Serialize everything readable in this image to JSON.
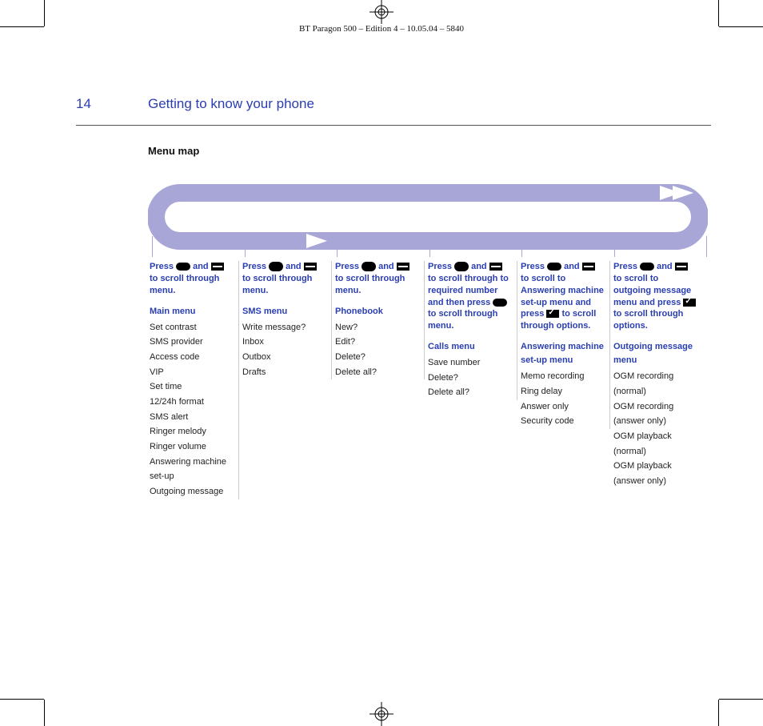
{
  "header": "BT Paragon 500 – Edition 4 – 10.05.04 – 5840",
  "page_number": "14",
  "section_title": "Getting to know your phone",
  "menu_map_heading": "Menu map",
  "cols": [
    {
      "instr_parts": {
        "pre": "Press ",
        "mid": " and ",
        "post": " to scroll through menu."
      },
      "lead_icon": "pill",
      "scroll_icon": "card",
      "menu_title": "Main menu",
      "items": [
        "Set contrast",
        "SMS provider",
        "Access code",
        "VIP",
        "Set time",
        "12/24h format",
        "SMS alert",
        "Ringer melody",
        "Ringer volume",
        "Answering machine set-up",
        "Outgoing message"
      ]
    },
    {
      "instr_parts": {
        "pre": "Press ",
        "mid": " and ",
        "post": " to scroll through menu."
      },
      "lead_icon": "oval",
      "scroll_icon": "card",
      "menu_title": "SMS menu",
      "items": [
        "Write message?",
        "Inbox",
        "Outbox",
        "Drafts"
      ]
    },
    {
      "instr_parts": {
        "pre": "Press ",
        "mid": " and ",
        "post": " to scroll through menu."
      },
      "lead_icon": "oval",
      "scroll_icon": "card",
      "menu_title": "Phonebook",
      "items": [
        "New?",
        "Edit?",
        "Delete?",
        "Delete all?"
      ]
    },
    {
      "instr_parts": {
        "pre": "Press ",
        "mid": " and ",
        "mid2": " to scroll through to required number and then press ",
        "post": " to scroll through menu."
      },
      "lead_icon": "oval",
      "pre_icon2": "card",
      "scroll_icon": "pill",
      "menu_title": "Calls menu",
      "items": [
        "Save number",
        "Delete?",
        "Delete all?"
      ]
    },
    {
      "instr_parts": {
        "pre": "Press ",
        "mid": " and ",
        "mid2": " to scroll to Answering machine set-up menu and press ",
        "post": " to scroll through options."
      },
      "lead_icon": "pill",
      "pre_icon2": "card",
      "scroll_icon": "check",
      "menu_title": "Answering machine set-up menu",
      "items": [
        "Memo recording",
        "Ring delay",
        "Answer only",
        "Security code"
      ]
    },
    {
      "instr_parts": {
        "pre": "Press ",
        "mid": " and ",
        "mid2": " to scroll to outgoing message menu and press ",
        "post": " to scroll through options."
      },
      "lead_icon": "pill",
      "pre_icon2": "card",
      "scroll_icon": "check",
      "menu_title": "Outgoing message menu",
      "items": [
        "OGM recording (normal)",
        "OGM recording (answer only)",
        "OGM playback (normal)",
        "OGM playback (answer only)"
      ]
    }
  ]
}
